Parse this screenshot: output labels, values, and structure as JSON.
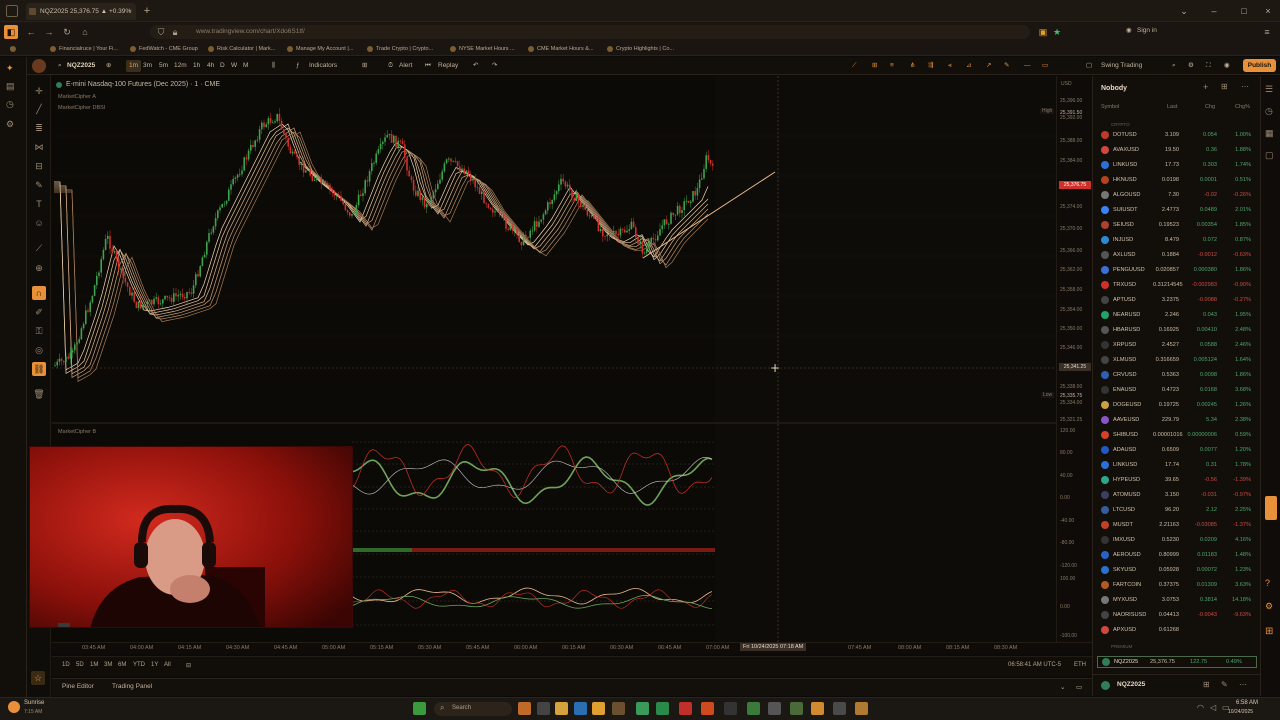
{
  "browser": {
    "tab_title": "NQZ2025 25,376.75 ▲ +0.39%",
    "url": "www.tradingview.com/chart/Xdo6S1tf/",
    "bookmarks": [
      "Financialruce | Your Fi...",
      "FedWatch - CME Group",
      "Risk Calculator | Mark...",
      "Manage My Account |...",
      "Trade Crypto | Crypto...",
      "NYSE Market Hours ...",
      "CME Market Hours &...",
      "Crypto Highlights | Co..."
    ]
  },
  "toolbar": {
    "symbol": "NQZ2025",
    "intervals": [
      "1m",
      "3m",
      "5m",
      "12m",
      "1h",
      "4h",
      "D",
      "W",
      "M"
    ],
    "indicators_label": "Indicators",
    "alert_label": "Alert",
    "replay_label": "Replay",
    "layout_name": "Swing Trading",
    "publish_label": "Publish",
    "sign_in": "Sign in"
  },
  "chart": {
    "title": "E-mini Nasdaq-100 Futures (Dec 2025) · 1 · CME",
    "indicator1": "MarketCipher A",
    "indicator2": "MarketCipher DBSI",
    "pane2_label": "MarketCipher B",
    "currency": "USD",
    "high_label": "High",
    "high_value": "25,391.50",
    "low_label": "Low",
    "low_value": "25,335.75",
    "cursor_price": "25,341.25",
    "last_price": "25,376.75",
    "price_ticks": [
      "25,396.00",
      "25,392.00",
      "25,388.00",
      "25,384.00",
      "25,379.00",
      "25,374.00",
      "25,370.00",
      "25,366.00",
      "25,362.00",
      "25,358.00",
      "25,354.00",
      "25,350.00",
      "25,346.00",
      "25,338.00",
      "25,334.00",
      "25,321.25"
    ],
    "osc_ticks": [
      "120.00",
      "80.00",
      "40.00",
      "0.00",
      "-40.00",
      "-80.00",
      "-120.00",
      "100.00",
      "0.00",
      "-100.00"
    ],
    "time_ticks": [
      "03:45 AM",
      "04:00 AM",
      "04:15 AM",
      "04:30 AM",
      "04:45 AM",
      "05:00 AM",
      "05:15 AM",
      "05:30 AM",
      "05:45 AM",
      "06:00 AM",
      "06:15 AM",
      "06:30 AM",
      "06:45 AM",
      "07:00 AM",
      "07:45 AM",
      "08:00 AM",
      "08:15 AM",
      "08:30 AM"
    ],
    "cursor_time": "Fri 10/24/2025  07:18 AM",
    "clock": "06:58:41 AM UTC-5",
    "session": "ETH"
  },
  "timeframes": [
    "1D",
    "5D",
    "1M",
    "3M",
    "6M",
    "YTD",
    "1Y",
    "All"
  ],
  "bottom_tabs": [
    "Pine Editor",
    "Trading Panel"
  ],
  "watchlist": {
    "name": "Nobody",
    "columns": [
      "Symbol",
      "Last",
      "Chg",
      "Chg%"
    ],
    "section1": "CRYPTO",
    "section2": "PREMIUM",
    "rows": [
      {
        "sym": "DOTUSD",
        "last": "3.109",
        "chg": "0.054",
        "pct": "1.00%",
        "dir": "pos",
        "color": "#c0392b"
      },
      {
        "sym": "AVAXUSD",
        "last": "19.50",
        "chg": "0.36",
        "pct": "1.88%",
        "dir": "pos",
        "color": "#d0493f"
      },
      {
        "sym": "LINKUSD",
        "last": "17.73",
        "chg": "0.303",
        "pct": "1.74%",
        "dir": "pos",
        "color": "#2c6fd6"
      },
      {
        "sym": "HKNUSD",
        "last": "0.0198",
        "chg": "0.0001",
        "pct": "0.51%",
        "dir": "pos",
        "color": "#b5441e"
      },
      {
        "sym": "ALGOUSD",
        "last": "7.30",
        "chg": "-0.02",
        "pct": "-0.26%",
        "dir": "neg",
        "color": "#777"
      },
      {
        "sym": "SUIUSDT",
        "last": "2.4773",
        "chg": "0.0489",
        "pct": "2.01%",
        "dir": "pos",
        "color": "#3b82f6"
      },
      {
        "sym": "SEIUSD",
        "last": "0.19523",
        "chg": "0.00354",
        "pct": "1.85%",
        "dir": "pos",
        "color": "#b04030"
      },
      {
        "sym": "INJUSD",
        "last": "8.479",
        "chg": "0.072",
        "pct": "0.87%",
        "dir": "pos",
        "color": "#2b8ad6"
      },
      {
        "sym": "AXLUSD",
        "last": "0.1884",
        "chg": "-0.0012",
        "pct": "-0.63%",
        "dir": "neg",
        "color": "#555"
      },
      {
        "sym": "PENGUUSD",
        "last": "0.020857",
        "chg": "0.000380",
        "pct": "1.86%",
        "dir": "pos",
        "color": "#3b6ed6"
      },
      {
        "sym": "TRXUSD",
        "last": "0.31214545",
        "chg": "-0.002983",
        "pct": "-0.90%",
        "dir": "neg",
        "color": "#d0302a"
      },
      {
        "sym": "APTUSD",
        "last": "3.2375",
        "chg": "-0.0088",
        "pct": "-0.27%",
        "dir": "neg",
        "color": "#444"
      },
      {
        "sym": "NEARUSD",
        "last": "2.246",
        "chg": "0.043",
        "pct": "1.95%",
        "dir": "pos",
        "color": "#22a36a"
      },
      {
        "sym": "HBARUSD",
        "last": "0.16925",
        "chg": "0.00410",
        "pct": "2.48%",
        "dir": "pos",
        "color": "#555"
      },
      {
        "sym": "XRPUSD",
        "last": "2.4527",
        "chg": "0.0588",
        "pct": "2.46%",
        "dir": "pos",
        "color": "#333"
      },
      {
        "sym": "XLMUSD",
        "last": "0.316659",
        "chg": "0.005124",
        "pct": "1.64%",
        "dir": "pos",
        "color": "#444"
      },
      {
        "sym": "CRVUSD",
        "last": "0.5363",
        "chg": "0.0098",
        "pct": "1.86%",
        "dir": "pos",
        "color": "#2f5fb3"
      },
      {
        "sym": "ENAUSD",
        "last": "0.4723",
        "chg": "0.0168",
        "pct": "3.68%",
        "dir": "pos",
        "color": "#333"
      },
      {
        "sym": "DOGEUSD",
        "last": "0.19725",
        "chg": "0.00245",
        "pct": "1.26%",
        "dir": "pos",
        "color": "#c8a240"
      },
      {
        "sym": "AAVEUSD",
        "last": "229.79",
        "chg": "5.34",
        "pct": "2.38%",
        "dir": "pos",
        "color": "#8a55c9"
      },
      {
        "sym": "SHIBUSD",
        "last": "0.00001016",
        "chg": "0.00000006",
        "pct": "0.59%",
        "dir": "pos",
        "color": "#d6402a"
      },
      {
        "sym": "ADAUSD",
        "last": "0.6509",
        "chg": "0.0077",
        "pct": "1.20%",
        "dir": "pos",
        "color": "#2457c5"
      },
      {
        "sym": "LINKUSD",
        "last": "17.74",
        "chg": "0.31",
        "pct": "1.78%",
        "dir": "pos",
        "color": "#2c6fd6"
      },
      {
        "sym": "HYPEUSD",
        "last": "39.65",
        "chg": "-0.56",
        "pct": "-1.39%",
        "dir": "neg",
        "color": "#2aa88a"
      },
      {
        "sym": "ATOMUSD",
        "last": "3.150",
        "chg": "-0.031",
        "pct": "-0.97%",
        "dir": "neg",
        "color": "#3a3f63"
      },
      {
        "sym": "LTCUSD",
        "last": "96.20",
        "chg": "2.12",
        "pct": "2.25%",
        "dir": "pos",
        "color": "#345d9d"
      },
      {
        "sym": "MUSDT",
        "last": "2.21163",
        "chg": "-0.03085",
        "pct": "-1.37%",
        "dir": "neg",
        "color": "#c2402a"
      },
      {
        "sym": "IMXUSD",
        "last": "0.5230",
        "chg": "0.0209",
        "pct": "4.16%",
        "dir": "pos",
        "color": "#333"
      },
      {
        "sym": "AEROUSD",
        "last": "0.80999",
        "chg": "0.01183",
        "pct": "1.48%",
        "dir": "pos",
        "color": "#2663c9"
      },
      {
        "sym": "SKYUSD",
        "last": "0.05928",
        "chg": "0.00072",
        "pct": "1.23%",
        "dir": "pos",
        "color": "#2a72d0"
      },
      {
        "sym": "FARTCOIN",
        "last": "0.37375",
        "chg": "0.01309",
        "pct": "3.63%",
        "dir": "pos",
        "color": "#b25a20"
      },
      {
        "sym": "MYXUSD",
        "last": "3.0753",
        "chg": "0.3814",
        "pct": "14.18%",
        "dir": "pos",
        "color": "#777"
      },
      {
        "sym": "NAORISUSD",
        "last": "0.04413",
        "chg": "-0.0043",
        "pct": "-9.63%",
        "dir": "neg",
        "color": "#444"
      },
      {
        "sym": "APXUSD",
        "last": "0.61268",
        "chg": "",
        "pct": "",
        "dir": "pos",
        "color": "#d0493f"
      }
    ],
    "premium_row": {
      "sym": "NQZ2025",
      "last": "25,376.75",
      "chg": "122.75",
      "pct": "0.49%"
    },
    "footer_symbol": "NQZ2025"
  },
  "taskbar": {
    "weather": "Sunrise",
    "weather_time": "7:15 AM",
    "search": "Search",
    "time": "6:58 AM",
    "date": "10/24/2025"
  }
}
